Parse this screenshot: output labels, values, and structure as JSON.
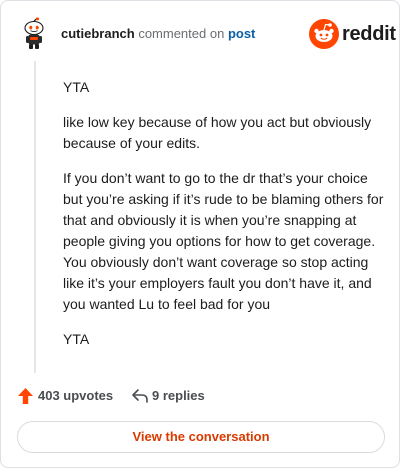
{
  "header": {
    "username": "cutiebranch",
    "action_text": "commented on",
    "post_link": "post",
    "brand_name": "reddit"
  },
  "comment": {
    "paragraphs": [
      "YTA",
      "like low key because of how you act but obviously because of your edits.",
      "If you don’t want to go to the dr that’s your choice but you’re asking if it’s rude to be blaming others for that and obviously it is when you’re snapping at people giving you options for how to get coverage. You obviously don’t want coverage so stop acting like it’s your employers fault you don’t have it, and you wanted Lu to feel bad for you",
      "YTA"
    ]
  },
  "actions": {
    "upvotes_label": "403 upvotes",
    "replies_label": "9 replies"
  },
  "footer": {
    "view_conversation_label": "View the conversation"
  },
  "icons": {
    "avatar": "snoo-avatar-icon",
    "brand": "reddit-logo-icon",
    "upvote": "upvote-arrow-icon",
    "reply": "reply-arrow-icon"
  },
  "colors": {
    "brand_orange": "#ff4500",
    "link_blue": "#0b5fa6",
    "cta_text": "#d93a00"
  }
}
